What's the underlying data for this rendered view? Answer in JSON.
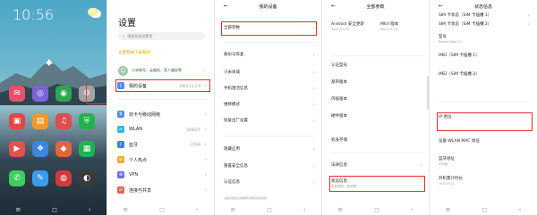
{
  "home": {
    "time": "10:56",
    "date": "",
    "weather_temp": "",
    "apps": [
      {
        "label": "",
        "color": "#e8506b",
        "glyph": "✉"
      },
      {
        "label": "",
        "color": "#7d63d8",
        "glyph": "◎"
      },
      {
        "label": "",
        "color": "#2aa84f",
        "glyph": "◉"
      },
      {
        "label": "",
        "color": "#a3a3a3",
        "glyph": "⚙"
      },
      {
        "label": "",
        "color": "#e8434a",
        "glyph": "▣"
      },
      {
        "label": "",
        "color": "#f19a2b",
        "glyph": "▤"
      },
      {
        "label": "",
        "color": "#e14c4c",
        "glyph": "♫"
      },
      {
        "label": "",
        "color": "#24b14d",
        "glyph": "⛨"
      },
      {
        "label": "",
        "color": "#e0524c",
        "glyph": "▶"
      },
      {
        "label": "",
        "color": "#3b87e0",
        "glyph": "❖"
      },
      {
        "label": "",
        "color": "#e26440",
        "glyph": "◆"
      },
      {
        "label": "",
        "color": "#1db354",
        "glyph": "▦"
      }
    ],
    "dock": [
      {
        "color": "#3ccf5d",
        "glyph": "✆"
      },
      {
        "color": "#3f9be8",
        "glyph": "✎"
      },
      {
        "color": "#d23a3a",
        "glyph": "◍"
      },
      {
        "color": "#3a3a3a",
        "glyph": "◐"
      }
    ]
  },
  "settings": {
    "title": "设置",
    "search_placeholder": "搜索系统设置项",
    "login_link": "立即登录小米账号",
    "profile_text": "小米账号、云服务、家人服务等",
    "my_device": "我的设备",
    "my_device_value": "MIUI 13.2.9",
    "rows": [
      {
        "label": "双卡与移动网络",
        "value": "",
        "color": "#4f8cf0",
        "glyph": "⇅"
      },
      {
        "label": "WLAN",
        "value": "DIRECT",
        "color": "#3cb3e6",
        "glyph": "≈"
      },
      {
        "label": "蓝牙",
        "value": "已关闭",
        "color": "#3f7ef0",
        "glyph": "ᛒ"
      },
      {
        "label": "个人热点",
        "value": "",
        "color": "#f0a636",
        "glyph": "◎"
      },
      {
        "label": "VPN",
        "value": "",
        "color": "#6d6dea",
        "glyph": "⊕"
      },
      {
        "label": "连接与共享",
        "value": "",
        "color": "#e55f57",
        "glyph": "⇄"
      }
    ]
  },
  "device": {
    "title": "我的设备",
    "all_params": "全部参数",
    "items": [
      "备份与恢复",
      "小米商城",
      "手机激活信息",
      "维修模式",
      "恢复出厂设置"
    ],
    "items2": [
      "隐藏应用",
      "重置安全信息",
      "认证信息"
    ],
    "footer": "设备基础信息的解释说明和隐私政策"
  },
  "params": {
    "title": "全部参数",
    "android_label": "Android 安全更新",
    "android_value": "2023-03-01",
    "miui_label": "MIUI 版本",
    "miui_value": "MIUI 13.2.9",
    "auth_model": "认证型号",
    "baseband": "基带版本",
    "kernel": "内核版本",
    "firmware": "硬件版本",
    "storage": "机身存储",
    "legal": "法律信息",
    "status": "状态信息",
    "status_sub": "本机号码、信号等"
  },
  "status": {
    "title": "状态信息",
    "sim1": "SIM 卡状态（SIM 卡插槽 1）",
    "sim2": "SIM 卡状态（SIM 卡插槽 2）",
    "model_label": "型号",
    "model_value": "Redmi Note 11",
    "imei1": "IMEI（SIM 卡插槽 1）",
    "imei2": "IMEI（SIM 卡插槽 2）",
    "ip_label": "IP 地址",
    "wlan_mac": "设备 WLAN MAC 地址",
    "bt_label": "蓝牙地址",
    "bt_value": "不可用",
    "uptime_label": "开机累计时长",
    "uptime_value": "793:53:21"
  }
}
